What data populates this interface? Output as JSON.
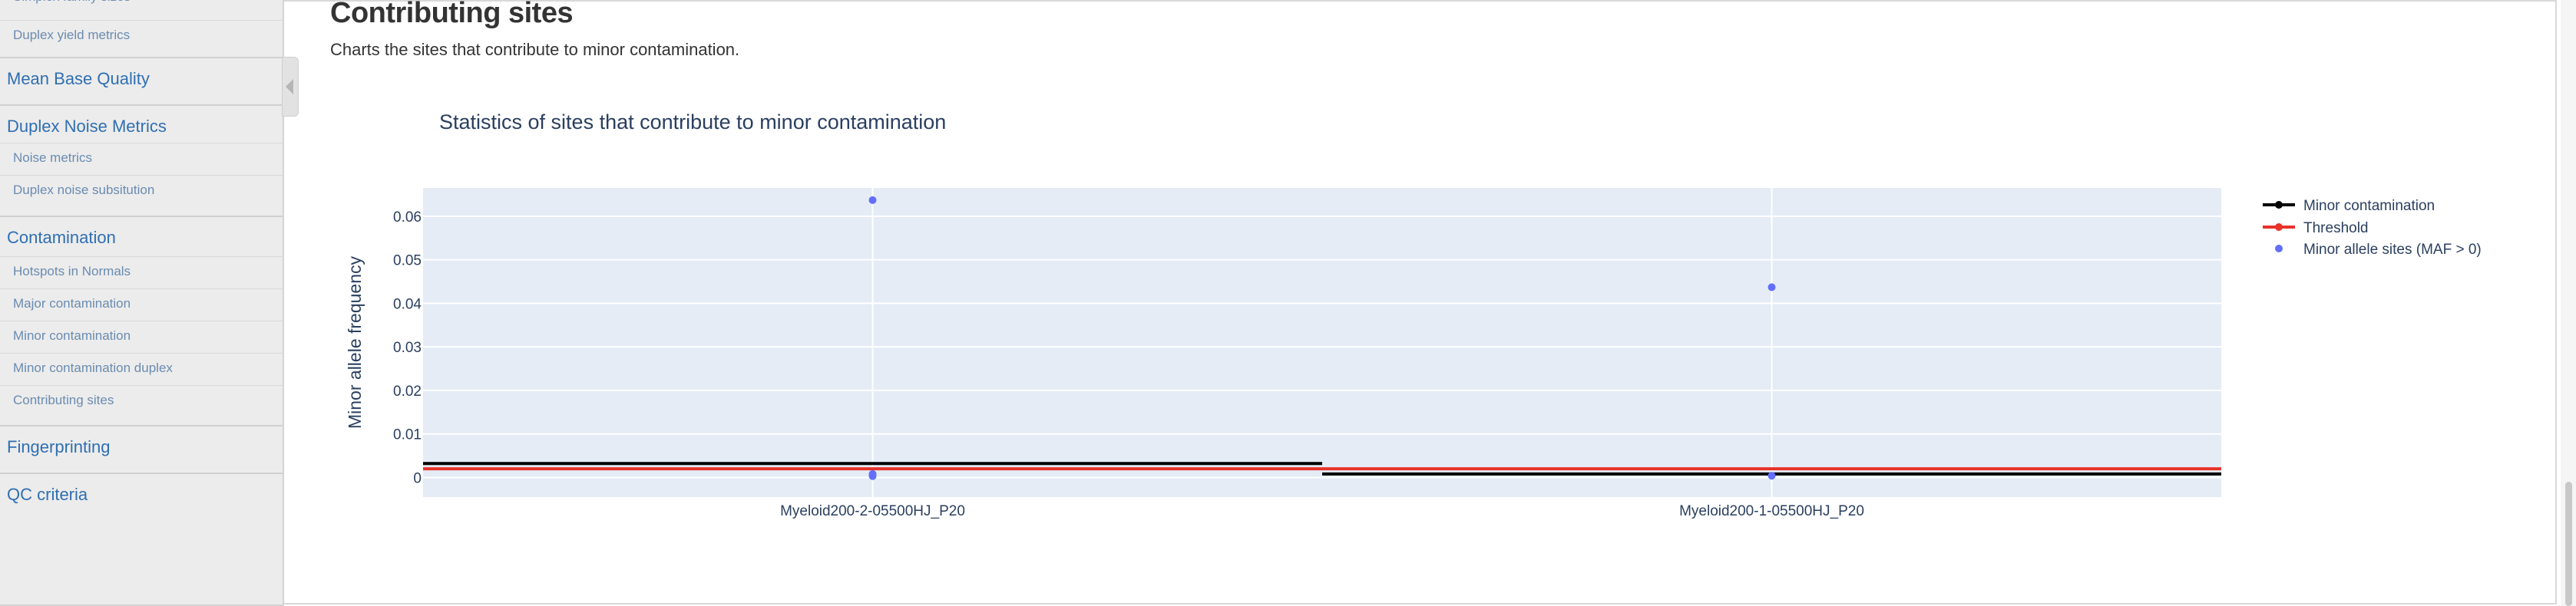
{
  "sidebar": {
    "partial_top": "Simplex family sizes",
    "items": [
      {
        "label": "Duplex yield metrics",
        "kind": "sub"
      },
      {
        "label": "Mean Base Quality",
        "kind": "group"
      },
      {
        "label": "Duplex Noise Metrics",
        "kind": "group"
      },
      {
        "label": "Noise metrics",
        "kind": "sub"
      },
      {
        "label": "Duplex noise subsitution",
        "kind": "sub"
      },
      {
        "label": "Contamination",
        "kind": "group"
      },
      {
        "label": "Hotspots in Normals",
        "kind": "sub"
      },
      {
        "label": "Major contamination",
        "kind": "sub"
      },
      {
        "label": "Minor contamination",
        "kind": "sub"
      },
      {
        "label": "Minor contamination duplex",
        "kind": "sub"
      },
      {
        "label": "Contributing sites",
        "kind": "sub"
      },
      {
        "label": "Fingerprinting",
        "kind": "group"
      },
      {
        "label": "QC criteria",
        "kind": "group"
      }
    ]
  },
  "section": {
    "title": "Contributing sites",
    "description": "Charts the sites that contribute to minor contamination."
  },
  "colors": {
    "plot_bg": "#e5ecf6",
    "contamination": "#000000",
    "threshold": "#e8322a",
    "sites": "#636efa",
    "title": "#2a3f5f"
  },
  "chart_data": {
    "type": "scatter",
    "title": "Statistics of sites that contribute to minor contamination",
    "ylabel": "Minor allele frequency",
    "xlabel": "",
    "categories": [
      "Myeloid200-2-05500HJ_P20",
      "Myeloid200-1-05500HJ_P20"
    ],
    "ylim": [
      -0.0045,
      0.0665
    ],
    "yticks": [
      0,
      0.01,
      0.02,
      0.03,
      0.04,
      0.05,
      0.06
    ],
    "ytick_labels": [
      "0",
      "0.01",
      "0.02",
      "0.03",
      "0.04",
      "0.05",
      "0.06"
    ],
    "grid": true,
    "legend_position": "top-right",
    "series": [
      {
        "name": "Minor contamination",
        "kind": "step",
        "values": [
          0.0032,
          0.0008
        ]
      },
      {
        "name": "Threshold",
        "kind": "step",
        "values": [
          0.002,
          0.002
        ]
      },
      {
        "name": "Minor allele sites (MAF > 0)",
        "kind": "points",
        "points": [
          {
            "category": 0,
            "y": 0.0637
          },
          {
            "category": 0,
            "y": 0.0008
          },
          {
            "category": 0,
            "y": 0.0003
          },
          {
            "category": 1,
            "y": 0.0437
          },
          {
            "category": 1,
            "y": 0.0004
          }
        ]
      }
    ]
  }
}
